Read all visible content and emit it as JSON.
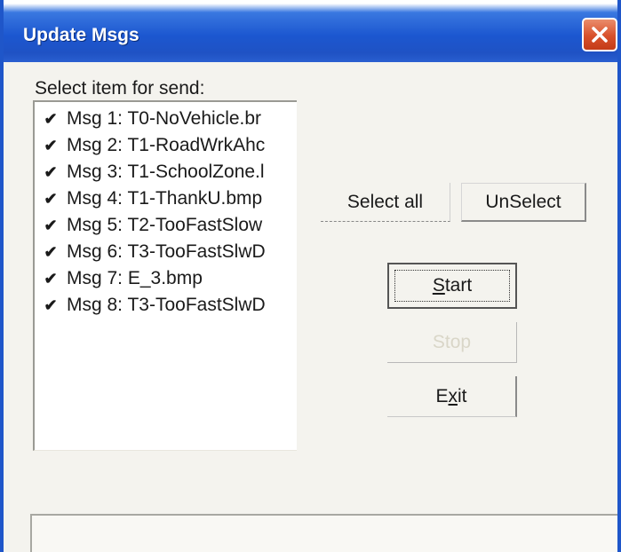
{
  "window": {
    "title": "Update Msgs"
  },
  "list": {
    "label": "Select item for send:",
    "items": [
      {
        "text": "Msg 1: T0-NoVehicle.br",
        "checked": true
      },
      {
        "text": "Msg 2: T1-RoadWrkAhc",
        "checked": true
      },
      {
        "text": "Msg 3: T1-SchoolZone.l",
        "checked": true
      },
      {
        "text": "Msg 4: T1-ThankU.bmp",
        "checked": true
      },
      {
        "text": "Msg 5: T2-TooFastSlow",
        "checked": true
      },
      {
        "text": "Msg 6: T3-TooFastSlwD",
        "checked": true
      },
      {
        "text": "Msg 7: E_3.bmp",
        "checked": true
      },
      {
        "text": "Msg 8: T3-TooFastSlwD",
        "checked": true
      }
    ]
  },
  "buttons": {
    "select_all": "Select all",
    "unselect": "UnSelect",
    "start_pre": "",
    "start_key": "S",
    "start_post": "tart",
    "stop": "Stop",
    "exit_pre": "E",
    "exit_key": "x",
    "exit_post": "it"
  },
  "icons": {
    "check": "✔",
    "close": "close-x-icon"
  }
}
